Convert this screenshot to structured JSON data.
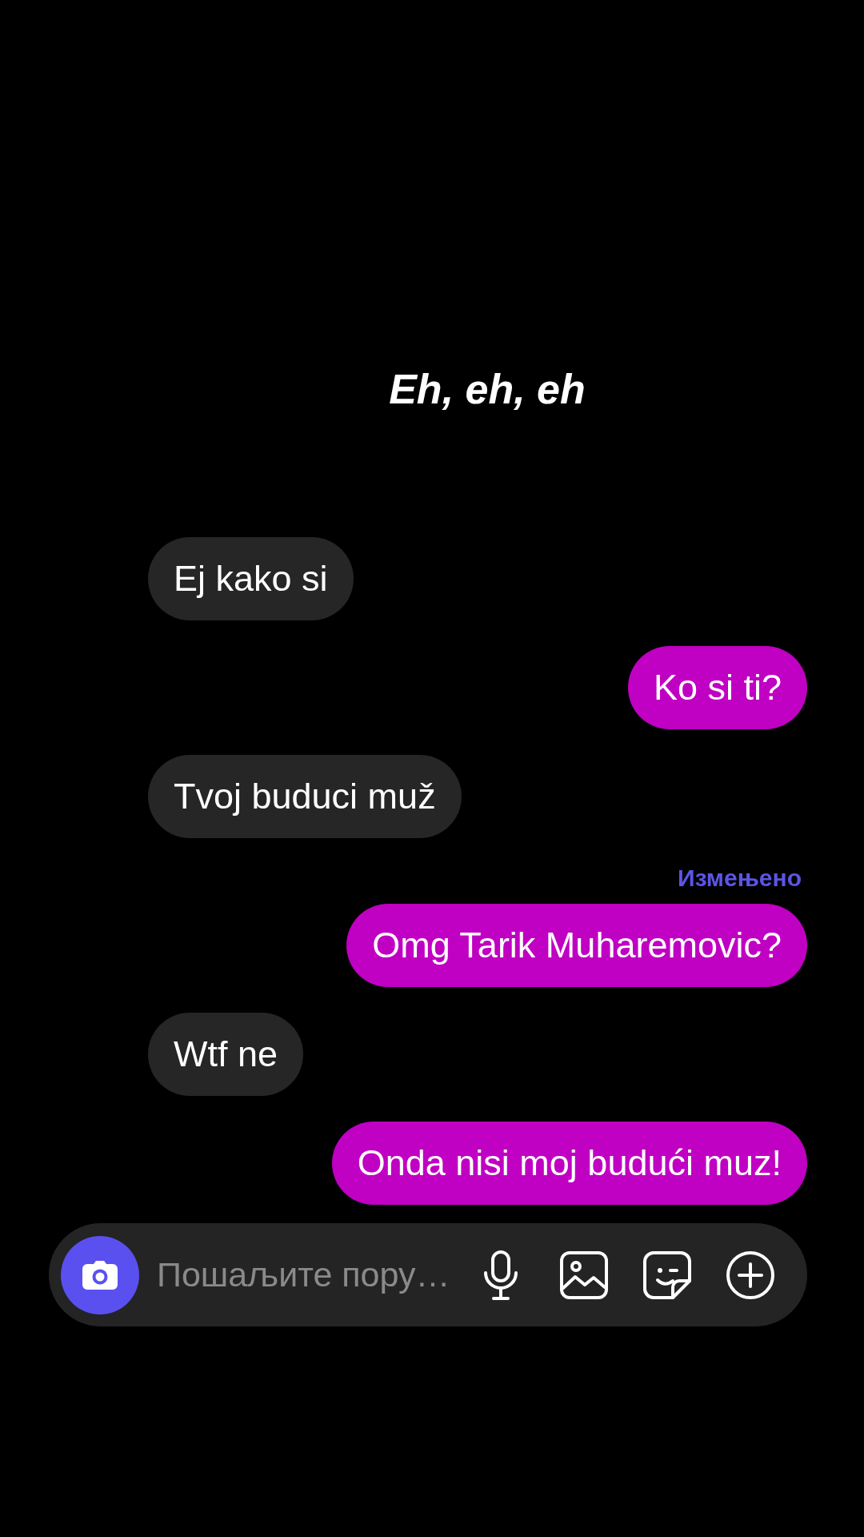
{
  "caption": "Eh, eh, eh",
  "messages": [
    {
      "kind": "incoming",
      "text": "Ej kako si"
    },
    {
      "kind": "outgoing",
      "text": "Ko si ti?"
    },
    {
      "kind": "incoming",
      "text": "Tvoj buduci muž"
    },
    {
      "kind": "outgoing",
      "edited_label": "Измењено",
      "text": "Omg Tarik Muharemovic?"
    },
    {
      "kind": "incoming",
      "text": "Wtf ne"
    },
    {
      "kind": "outgoing",
      "text": "Onda nisi moj budući muz!"
    }
  ],
  "composer": {
    "placeholder": "Пошаљите пору…"
  }
}
